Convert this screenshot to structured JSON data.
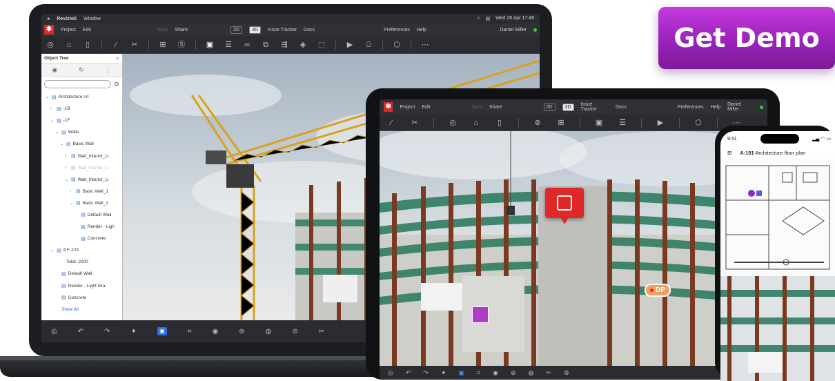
{
  "cta": {
    "label": "Get Demo",
    "color": "#a92bc8"
  },
  "laptop": {
    "mac_menu": {
      "app": "Revizto5",
      "window": "Window",
      "datetime": "Wed 28 Apr 17:48"
    },
    "menu": {
      "project": "Project",
      "edit": "Edit",
      "sync": "Sync",
      "share": "Share",
      "mode_2d": "2D",
      "mode_3d": "3D",
      "issue_tracker": "Issue Tracker",
      "docs": "Docs",
      "preferences": "Preferences",
      "help": "Help",
      "user": "Daniel Miller"
    },
    "object_tree": {
      "title": "Object Tree",
      "items": [
        {
          "label": "Architecture.rvt",
          "level": 0,
          "chev": "⌄"
        },
        {
          "label": "-1B",
          "level": 1,
          "chev": "›"
        },
        {
          "label": "-1F",
          "level": 1,
          "chev": "⌄"
        },
        {
          "label": "Walls",
          "level": 2,
          "chev": "⌄"
        },
        {
          "label": "Basic Wall",
          "level": 3,
          "chev": "⌄"
        },
        {
          "label": "Wall_Interior_Li",
          "level": 4,
          "chev": "›"
        },
        {
          "label": "Wall_Interior_Li",
          "level": 4,
          "chev": "›",
          "dim": true
        },
        {
          "label": "Wall_Interior_Li",
          "level": 4,
          "chev": "⌄"
        },
        {
          "label": "Basic Wall_1",
          "level": 5,
          "chev": "›"
        },
        {
          "label": "Basic Wall_2",
          "level": 5,
          "chev": "⌄"
        },
        {
          "label": "Default Wall",
          "level": 6,
          "chev": ""
        },
        {
          "label": "Render - Ligh",
          "level": 6,
          "chev": ""
        },
        {
          "label": "Concrete",
          "level": 6,
          "chev": ""
        },
        {
          "label": "4 F-223",
          "level": 1,
          "chev": "⌄"
        },
        {
          "label": "Total: 2000",
          "level": 3,
          "chev": "",
          "plain": true
        },
        {
          "label": "Default Wall",
          "level": 2,
          "chev": ""
        },
        {
          "label": "Render - Light Gra",
          "level": 2,
          "chev": ""
        },
        {
          "label": "Concrete",
          "level": 2,
          "chev": ""
        },
        {
          "label": "Show All",
          "level": 2,
          "chev": "",
          "link": true
        }
      ]
    }
  },
  "tablet": {
    "menu": {
      "project": "Project",
      "edit": "Edit",
      "sync": "Sync",
      "share": "Share",
      "mode_2d": "2D",
      "mode_3d": "3D",
      "issue_tracker": "Issue Tracker",
      "docs": "Docs",
      "preferences": "Preferences",
      "help": "Help",
      "user": "Daniel Miller"
    },
    "issue_tag": "DP"
  },
  "phone": {
    "time": "9:41",
    "sheet_code": "A-101",
    "sheet_title": "Architecture floor plan"
  }
}
